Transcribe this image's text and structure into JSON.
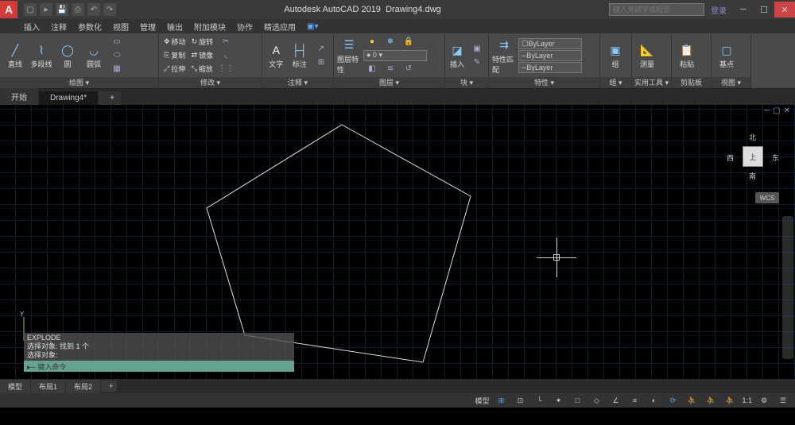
{
  "title": {
    "app": "Autodesk AutoCAD 2019",
    "file": "Drawing4.dwg",
    "logo": "A"
  },
  "search": {
    "placeholder": "键入关键字或短语"
  },
  "login": "登录",
  "menu": [
    "插入",
    "注释",
    "参数化",
    "视图",
    "管理",
    "输出",
    "附加模块",
    "协作",
    "精选应用"
  ],
  "panels": {
    "draw": {
      "title": "绘图 ▾",
      "line": "直线",
      "pline": "多段线",
      "circle": "圆",
      "arc": "圆弧"
    },
    "modify": {
      "title": "修改 ▾",
      "move": "移动",
      "rotate": "旋转",
      "copy": "复制",
      "mirror": "镜像",
      "stretch": "拉伸",
      "scale": "缩放"
    },
    "annot": {
      "title": "注释 ▾",
      "text": "文字",
      "dim": "标注"
    },
    "layer": {
      "title": "图层 ▾",
      "props": "图层特性"
    },
    "block": {
      "title": "块 ▾",
      "insert": "插入"
    },
    "props": {
      "title": "特性 ▾",
      "match": "特性匹配",
      "bylayer": "ByLayer"
    },
    "group": {
      "title": "组 ▾",
      "group": "组"
    },
    "utils": {
      "title": "实用工具 ▾",
      "measure": "测量"
    },
    "clip": {
      "title": "剪贴板",
      "paste": "粘贴"
    },
    "view": {
      "title": "视图 ▾",
      "base": "基点"
    }
  },
  "doctabs": {
    "start": "开始",
    "active": "Drawing4*"
  },
  "viewcube": {
    "top": "上",
    "n": "北",
    "s": "南",
    "e": "东",
    "w": "西",
    "wcs": "WCS"
  },
  "cmd": {
    "l1": "EXPLODE",
    "l2": "选择对象: 找到 1 个",
    "l3": "选择对象:",
    "prompt": "▸─ 键入命令"
  },
  "btabs": {
    "model": "模型",
    "l1": "布局1",
    "l2": "布局2"
  },
  "status": {
    "model": "模型",
    "scale": "1:1"
  }
}
